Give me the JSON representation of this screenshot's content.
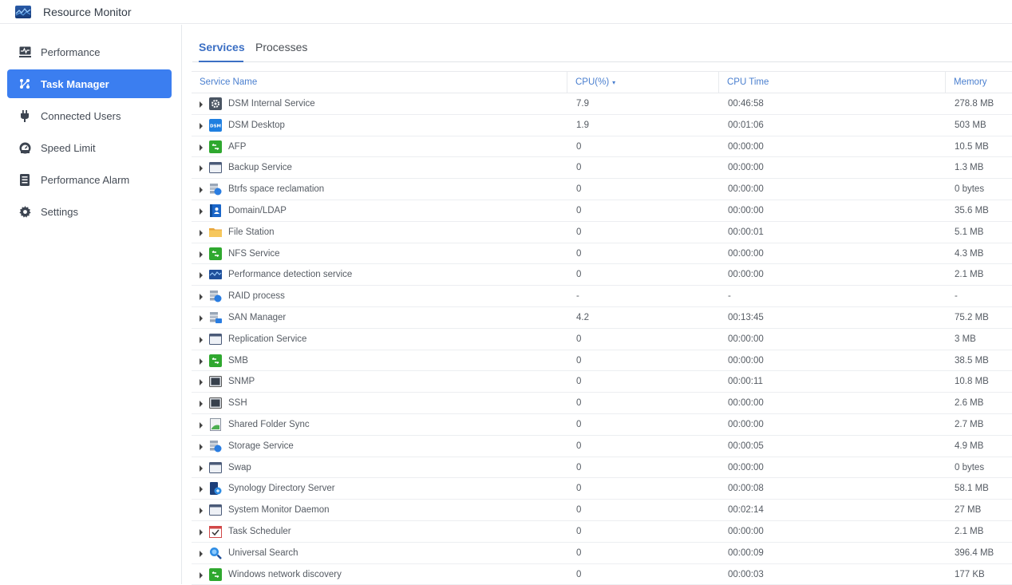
{
  "app": {
    "title": "Resource Monitor",
    "icon": "resource-monitor-icon"
  },
  "sidebar": {
    "items": [
      {
        "label": "Performance",
        "icon": "performance-icon",
        "active": false
      },
      {
        "label": "Task Manager",
        "icon": "task-manager-icon",
        "active": true
      },
      {
        "label": "Connected Users",
        "icon": "plug-icon",
        "active": false
      },
      {
        "label": "Speed Limit",
        "icon": "gauge-icon",
        "active": false
      },
      {
        "label": "Performance Alarm",
        "icon": "alarm-document-icon",
        "active": false
      },
      {
        "label": "Settings",
        "icon": "gear-icon",
        "active": false
      }
    ]
  },
  "tabs": [
    {
      "label": "Services",
      "active": true
    },
    {
      "label": "Processes",
      "active": false
    }
  ],
  "table": {
    "columns": {
      "name": "Service Name",
      "cpu": "CPU(%)",
      "cpu_sort": "▾",
      "time": "CPU Time",
      "memory": "Memory"
    },
    "rows": [
      {
        "name": "DSM Internal Service",
        "icon": "gear-box-icon",
        "cpu": "7.9",
        "time": "00:46:58",
        "memory": "278.8 MB"
      },
      {
        "name": "DSM Desktop",
        "icon": "dsm-icon",
        "cpu": "1.9",
        "time": "00:01:06",
        "memory": "503 MB"
      },
      {
        "name": "AFP",
        "icon": "file-service-icon",
        "cpu": "0",
        "time": "00:00:00",
        "memory": "10.5 MB"
      },
      {
        "name": "Backup Service",
        "icon": "window-icon",
        "cpu": "0",
        "time": "00:00:00",
        "memory": "1.3 MB"
      },
      {
        "name": "Btrfs space reclamation",
        "icon": "storage-icon",
        "cpu": "0",
        "time": "00:00:00",
        "memory": "0 bytes"
      },
      {
        "name": "Domain/LDAP",
        "icon": "directory-icon",
        "cpu": "0",
        "time": "00:00:00",
        "memory": "35.6 MB"
      },
      {
        "name": "File Station",
        "icon": "folder-icon",
        "cpu": "0",
        "time": "00:00:01",
        "memory": "5.1 MB"
      },
      {
        "name": "NFS Service",
        "icon": "file-service-icon",
        "cpu": "0",
        "time": "00:00:00",
        "memory": "4.3 MB"
      },
      {
        "name": "Performance detection service",
        "icon": "resource-monitor-icon",
        "cpu": "0",
        "time": "00:00:00",
        "memory": "2.1 MB"
      },
      {
        "name": "RAID process",
        "icon": "storage-icon",
        "cpu": "-",
        "time": "-",
        "memory": "-"
      },
      {
        "name": "SAN Manager",
        "icon": "san-icon",
        "cpu": "4.2",
        "time": "00:13:45",
        "memory": "75.2 MB"
      },
      {
        "name": "Replication Service",
        "icon": "window-icon",
        "cpu": "0",
        "time": "00:00:00",
        "memory": "3 MB"
      },
      {
        "name": "SMB",
        "icon": "file-service-icon",
        "cpu": "0",
        "time": "00:00:00",
        "memory": "38.5 MB"
      },
      {
        "name": "SNMP",
        "icon": "terminal-icon",
        "cpu": "0",
        "time": "00:00:11",
        "memory": "10.8 MB"
      },
      {
        "name": "SSH",
        "icon": "terminal-icon",
        "cpu": "0",
        "time": "00:00:00",
        "memory": "2.6 MB"
      },
      {
        "name": "Shared Folder Sync",
        "icon": "folder-sync-icon",
        "cpu": "0",
        "time": "00:00:00",
        "memory": "2.7 MB"
      },
      {
        "name": "Storage Service",
        "icon": "storage-icon",
        "cpu": "0",
        "time": "00:00:05",
        "memory": "4.9 MB"
      },
      {
        "name": "Swap",
        "icon": "window-icon",
        "cpu": "0",
        "time": "00:00:00",
        "memory": "0 bytes"
      },
      {
        "name": "Synology Directory Server",
        "icon": "directory-server-icon",
        "cpu": "0",
        "time": "00:00:08",
        "memory": "58.1 MB"
      },
      {
        "name": "System Monitor Daemon",
        "icon": "window-icon",
        "cpu": "0",
        "time": "00:02:14",
        "memory": "27 MB"
      },
      {
        "name": "Task Scheduler",
        "icon": "calendar-check-icon",
        "cpu": "0",
        "time": "00:00:00",
        "memory": "2.1 MB"
      },
      {
        "name": "Universal Search",
        "icon": "magnifier-icon",
        "cpu": "0",
        "time": "00:00:09",
        "memory": "396.4 MB"
      },
      {
        "name": "Windows network discovery",
        "icon": "file-service-icon",
        "cpu": "0",
        "time": "00:00:03",
        "memory": "177 KB"
      }
    ]
  },
  "colors": {
    "accent": "#3b7ef0",
    "tab_active": "#3b6fc4",
    "header_text": "#4a7fcf"
  }
}
